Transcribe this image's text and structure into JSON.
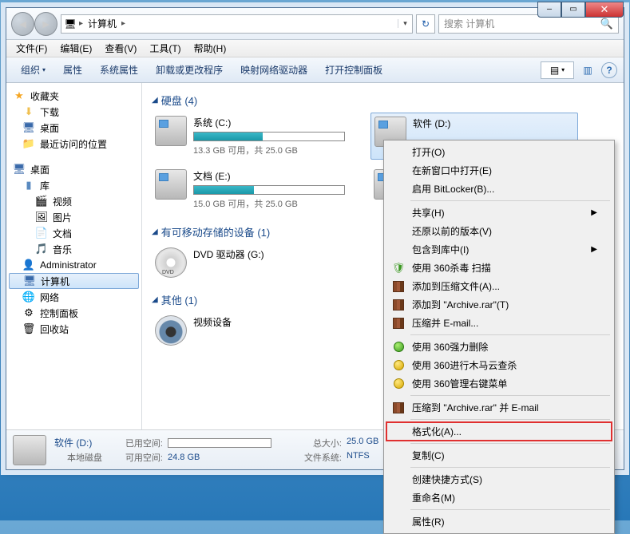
{
  "titlebar": {
    "min": "—",
    "max": "▭",
    "close": "✕"
  },
  "nav": {
    "back": "◄",
    "fwd": "►",
    "crumb_root": "▸",
    "crumb1": "计算机",
    "crumb_sep": "▸",
    "dd": "▾",
    "refresh": "↻",
    "search_placeholder": "搜索 计算机",
    "search_icon": "🔍"
  },
  "menubar": [
    "文件(F)",
    "编辑(E)",
    "查看(V)",
    "工具(T)",
    "帮助(H)"
  ],
  "toolbar": {
    "items": [
      "组织",
      "属性",
      "系统属性",
      "卸载或更改程序",
      "映射网络驱动器",
      "打开控制面板"
    ],
    "chev": "▾",
    "view_icon": "▤",
    "preview_icon": "▥",
    "help_icon": "?"
  },
  "sidebar": {
    "fav": {
      "label": "收藏夹",
      "items": [
        "下载",
        "桌面",
        "最近访问的位置"
      ]
    },
    "desk": {
      "label": "桌面",
      "lib": {
        "label": "库",
        "items": [
          "视频",
          "图片",
          "文档",
          "音乐"
        ]
      },
      "admin": "Administrator",
      "computer": "计算机",
      "network": "网络",
      "cpanel": "控制面板",
      "recycle": "回收站"
    }
  },
  "content": {
    "sec_hdd": "硬盘 (4)",
    "sec_removable": "有可移动存储的设备 (1)",
    "sec_other": "其他 (1)",
    "drives": [
      {
        "name": "系统 (C:)",
        "fill": 46,
        "space": "13.3 GB 可用，共 25.0 GB"
      },
      {
        "name": "软件 (D:)",
        "fill": 2,
        "space": ""
      },
      {
        "name": "文档 (E:)",
        "fill": 40,
        "space": "15.0 GB 可用，共 25.0 GB"
      },
      {
        "name": "",
        "fill": 0,
        "space": ""
      }
    ],
    "dvd": "DVD 驱动器 (G:)",
    "other": "视频设备"
  },
  "status": {
    "title": "软件 (D:)",
    "label_used": "已用空间:",
    "label_type": "本地磁盘",
    "label_free": "可用空间:",
    "free_val": "24.8 GB",
    "label_total": "总大小:",
    "total_val": "25.0 GB",
    "label_fs": "文件系统:",
    "fs_val": "NTFS"
  },
  "ctx": {
    "items": [
      {
        "t": "打开(O)"
      },
      {
        "t": "在新窗口中打开(E)"
      },
      {
        "t": "启用 BitLocker(B)..."
      },
      {
        "sep": true
      },
      {
        "t": "共享(H)",
        "sub": true
      },
      {
        "t": "还原以前的版本(V)"
      },
      {
        "t": "包含到库中(I)",
        "sub": true
      },
      {
        "t": "使用 360杀毒 扫描",
        "icon": "shield"
      },
      {
        "t": "添加到压缩文件(A)...",
        "icon": "books"
      },
      {
        "t": "添加到 \"Archive.rar\"(T)",
        "icon": "books"
      },
      {
        "t": "压缩并 E-mail...",
        "icon": "books"
      },
      {
        "sep": true
      },
      {
        "t": "使用 360强力删除",
        "icon": "green"
      },
      {
        "t": "使用 360进行木马云查杀",
        "icon": "yellow"
      },
      {
        "t": "使用 360管理右键菜单",
        "icon": "yellow"
      },
      {
        "sep": true
      },
      {
        "t": "压缩到 \"Archive.rar\" 并 E-mail",
        "icon": "books"
      },
      {
        "sep": true
      },
      {
        "t": "格式化(A)...",
        "hl": true
      },
      {
        "sep": true
      },
      {
        "t": "复制(C)"
      },
      {
        "sep": true
      },
      {
        "t": "创建快捷方式(S)"
      },
      {
        "t": "重命名(M)"
      },
      {
        "sep": true
      },
      {
        "t": "属性(R)"
      }
    ]
  }
}
